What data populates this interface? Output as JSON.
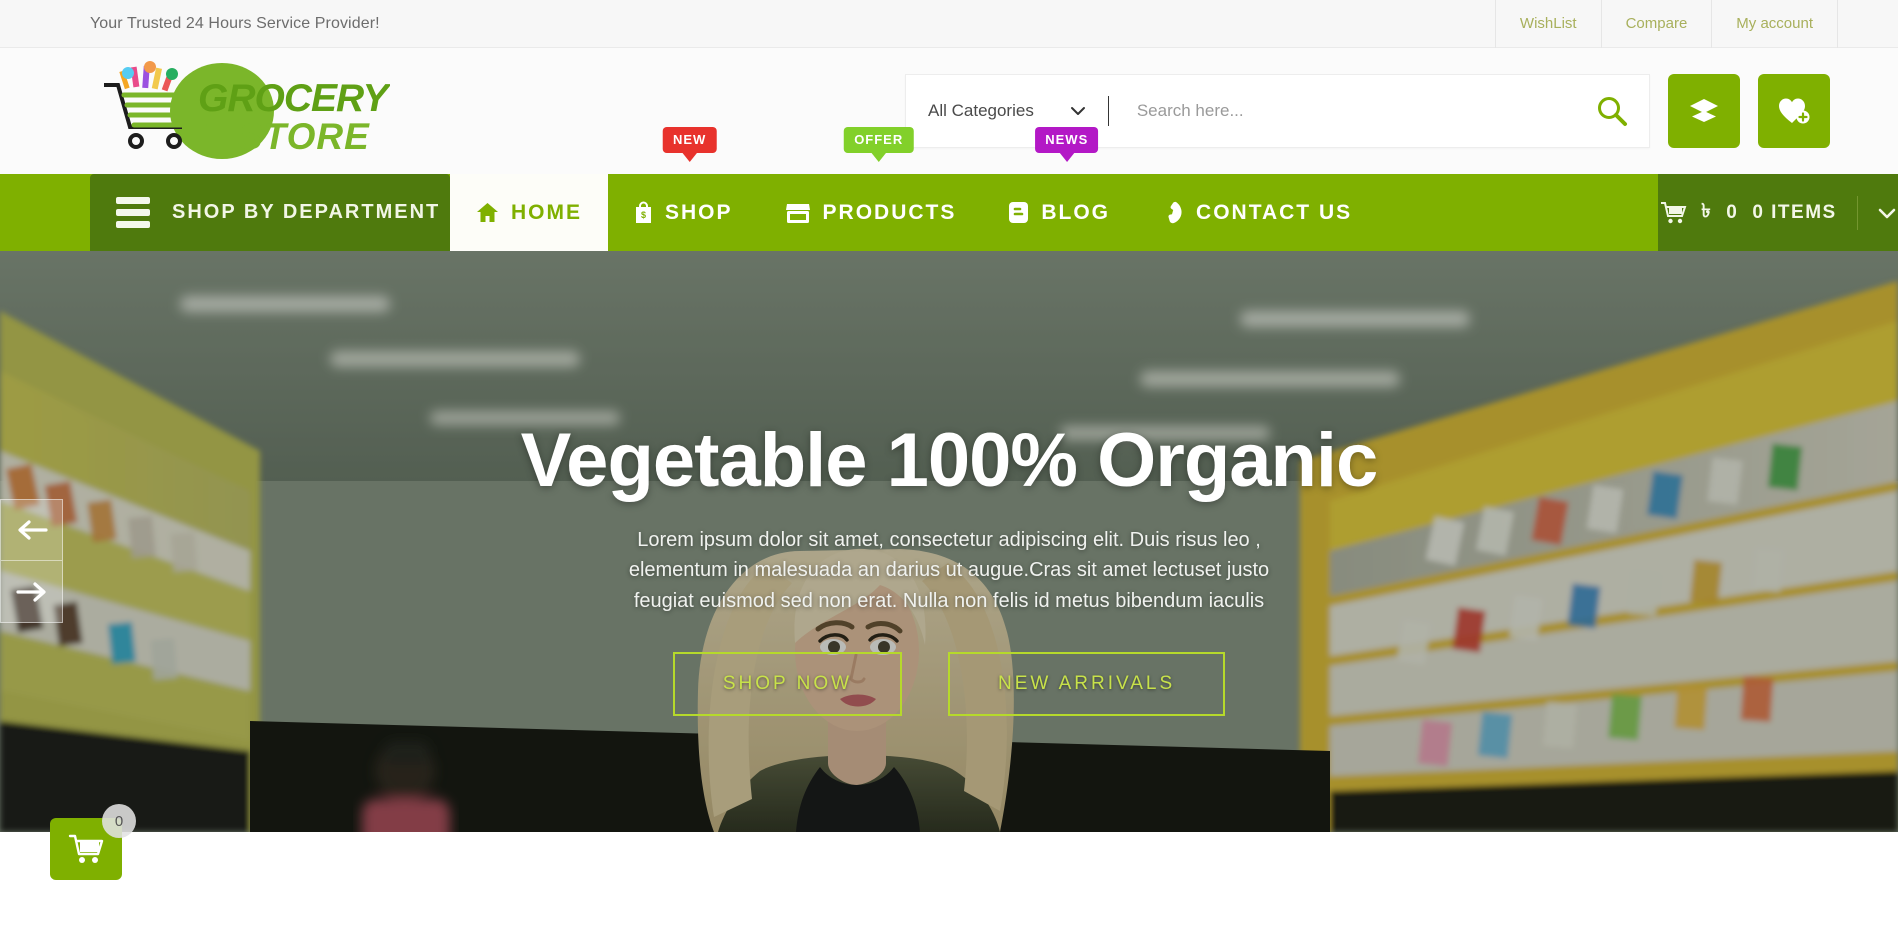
{
  "topbar": {
    "message": "Your Trusted 24 Hours Service Provider!",
    "links": [
      {
        "label": "WishList",
        "name": "wishlist"
      },
      {
        "label": "Compare",
        "name": "compare"
      },
      {
        "label": "My account",
        "name": "my-account"
      }
    ]
  },
  "brand": {
    "line1": "GROCERY",
    "line2": "STORE",
    "color": "#6fae1e",
    "color_dark": "#4f8a16"
  },
  "search": {
    "category_label": "All Categories",
    "placeholder": "Search here...",
    "value": "",
    "search_icon": "search-icon",
    "compare_icon": "layers-icon",
    "wishlist_icon": "heart-plus-icon"
  },
  "nav": {
    "department_label": "SHOP BY DEPARTMENT",
    "items": [
      {
        "label": "HOME",
        "icon": "home-icon",
        "active": true,
        "badge": null,
        "badge_color": null
      },
      {
        "label": "SHOP",
        "icon": "shopping-bag-icon",
        "active": false,
        "badge": "NEW",
        "badge_color": "#e8322c"
      },
      {
        "label": "PRODUCTS",
        "icon": "store-icon",
        "active": false,
        "badge": "OFFER",
        "badge_color": "#82d02a"
      },
      {
        "label": "BLOG",
        "icon": "blogger-icon",
        "active": false,
        "badge": "NEWS",
        "badge_color": "#b318c6"
      },
      {
        "label": "CONTACT US",
        "icon": "phone-icon",
        "active": false,
        "badge": null,
        "badge_color": null
      }
    ],
    "cart": {
      "currency": "৳",
      "amount": "0",
      "items_label": "0 ITEMS",
      "icon": "cart-icon",
      "chevron": "chevron-down-icon"
    },
    "bar_color": "#7fb000",
    "dark_color": "#4f7a0d"
  },
  "hero": {
    "title": "Vegetable 100% Organic",
    "paragraph": "Lorem ipsum dolor sit amet, consectetur adipiscing elit. Duis risus leo , elementum in malesuada an darius ut augue.Cras sit amet lectuset justo feugiat euismod sed non erat. Nulla non felis id metus bibendum iaculis",
    "primary_btn": "SHOP NOW",
    "secondary_btn": "NEW ARRIVALS",
    "prev_label": "Previous slide",
    "next_label": "Next slide",
    "btn_color": "#c8e24a"
  },
  "float_cart": {
    "count": "0",
    "icon": "cart-icon"
  }
}
